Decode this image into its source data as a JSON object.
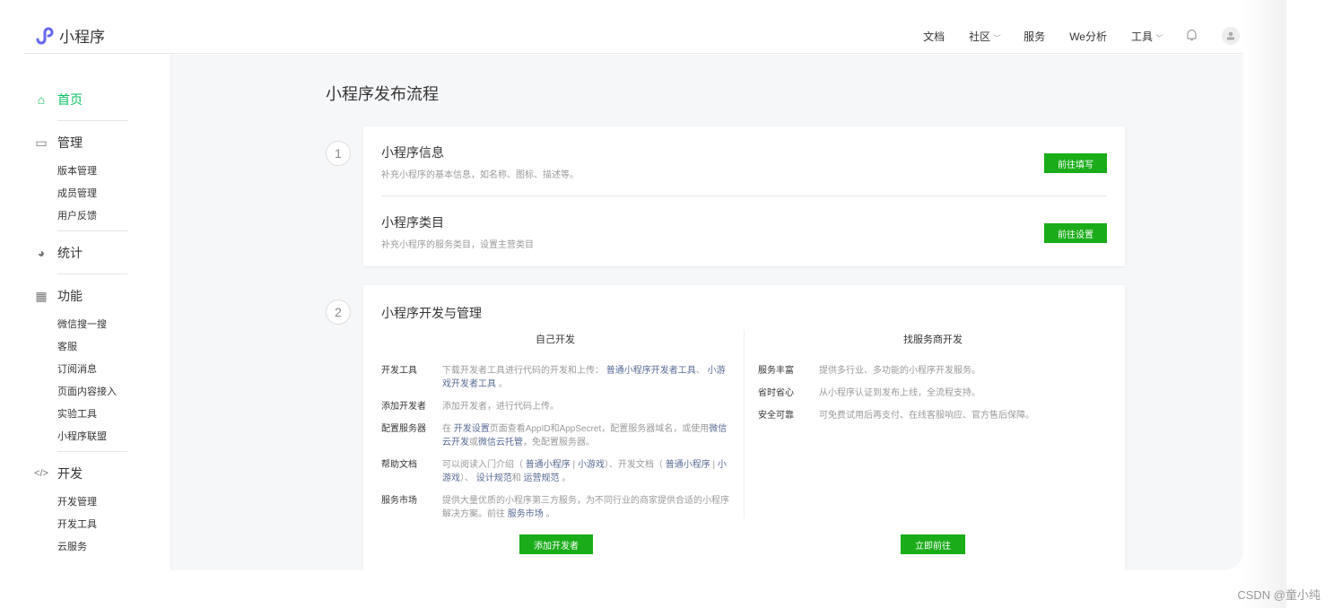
{
  "header": {
    "logo": "小程序",
    "nav": [
      "文档",
      "社区",
      "服务",
      "We分析",
      "工具"
    ]
  },
  "sidebar": {
    "home": "首页",
    "manage": "管理",
    "manage_items": [
      "版本管理",
      "成员管理",
      "用户反馈"
    ],
    "stats": "统计",
    "features": "功能",
    "feature_items": [
      "微信搜一搜",
      "客服",
      "订阅消息",
      "页面内容接入",
      "实验工具",
      "小程序联盟"
    ],
    "dev": "开发",
    "dev_items": [
      "开发管理",
      "开发工具",
      "云服务"
    ]
  },
  "main": {
    "title": "小程序发布流程",
    "step1": {
      "num": "1",
      "rows": [
        {
          "title": "小程序信息",
          "desc": "补充小程序的基本信息，如名称、图标、描述等。",
          "button": "前往填写"
        },
        {
          "title": "小程序类目",
          "desc": "补充小程序的服务类目，设置主营类目",
          "button": "前往设置"
        }
      ]
    },
    "step2": {
      "num": "2",
      "title": "小程序开发与管理",
      "self": {
        "heading": "自己开发",
        "button": "添加开发者",
        "items": [
          {
            "k": "开发工具",
            "v": [
              [
                "下载开发者工具进行代码的开发和上传： ",
                0
              ],
              [
                "普通小程序开发者工具",
                1
              ],
              [
                "、 ",
                0
              ],
              [
                "小游戏开发者工具",
                1
              ],
              [
                " 。",
                0
              ]
            ]
          },
          {
            "k": "添加开发者",
            "v": [
              [
                "添加开发者，进行代码上传。",
                0
              ]
            ]
          },
          {
            "k": "配置服务器",
            "v": [
              [
                "在 ",
                0
              ],
              [
                "开发设置",
                1
              ],
              [
                "页面查看AppID和AppSecret，配置服务器域名，或使用",
                0
              ],
              [
                "微信云开发",
                1
              ],
              [
                "或",
                0
              ],
              [
                "微信云托管",
                1
              ],
              [
                "，免配置服务器。",
                0
              ]
            ]
          },
          {
            "k": "帮助文档",
            "v": [
              [
                "可以阅读入门介绍（ ",
                0
              ],
              [
                "普通小程序",
                1
              ],
              [
                " | ",
                0
              ],
              [
                "小游戏",
                1
              ],
              [
                "）、开发文档（ ",
                0
              ],
              [
                "普通小程序",
                1
              ],
              [
                " | ",
                0
              ],
              [
                "小游戏",
                1
              ],
              [
                "）、 ",
                0
              ],
              [
                "设计规范",
                1
              ],
              [
                "和 ",
                0
              ],
              [
                "运营规范",
                1
              ],
              [
                " 。",
                0
              ]
            ]
          },
          {
            "k": "服务市场",
            "v": [
              [
                "提供大量优质的小程序第三方服务，为不同行业的商家提供合适的小程序解决方案。前往 ",
                0
              ],
              [
                "服务市场",
                1
              ],
              [
                " 。",
                0
              ]
            ]
          }
        ]
      },
      "vendor": {
        "heading": "找服务商开发",
        "button": "立即前往",
        "items": [
          {
            "k": "服务丰富",
            "v": [
              [
                "提供多行业、多功能的小程序开发服务。",
                0
              ]
            ]
          },
          {
            "k": "省时省心",
            "v": [
              [
                "从小程序认证到发布上线，全流程支持。",
                0
              ]
            ]
          },
          {
            "k": "安全可靠",
            "v": [
              [
                "可免费试用后再支付、在线客服响应、官方售后保障。",
                0
              ]
            ]
          }
        ]
      }
    }
  },
  "watermark": "CSDN @童小纯",
  "colors": {
    "accent": "#07c160",
    "button": "#1aad19",
    "link": "#576b95"
  }
}
